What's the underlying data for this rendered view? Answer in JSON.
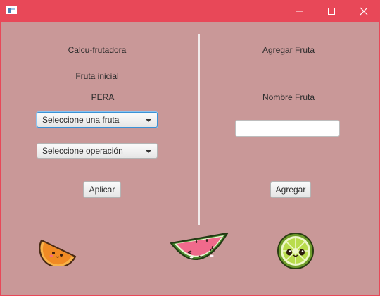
{
  "window": {
    "title": "",
    "app_icon": "window-icon",
    "controls": {
      "minimize": "minimize-icon",
      "maximize": "maximize-icon",
      "close": "close-icon"
    }
  },
  "colors": {
    "titlebar": "#e84858",
    "background": "#c99898",
    "divider": "#f2eaea",
    "focus": "#3a92d6"
  },
  "left": {
    "title": "Calcu-frutadora",
    "initial_label": "Fruta inicial",
    "initial_value": "PERA",
    "fruit_select": {
      "selected": "Seleccione una fruta"
    },
    "operation_select": {
      "selected": "Seleccione operación"
    },
    "apply_button": "Aplicar"
  },
  "right": {
    "title": "Agregar Fruta",
    "name_label": "Nombre Fruta",
    "name_input": {
      "value": "",
      "placeholder": ""
    },
    "add_button": "Agregar"
  },
  "decorations": [
    "orange-slice-icon",
    "watermelon-slice-icon",
    "lime-slice-icon"
  ]
}
